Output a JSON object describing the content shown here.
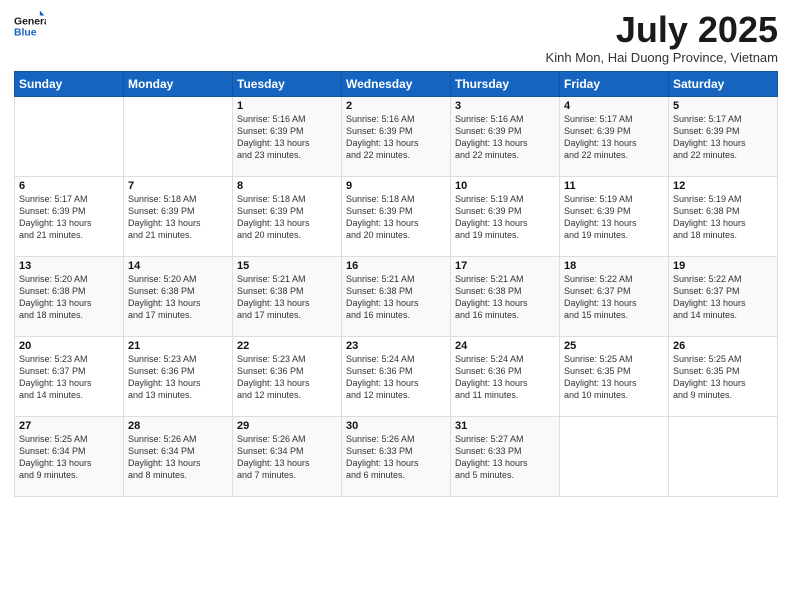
{
  "header": {
    "logo_line1": "General",
    "logo_line2": "Blue",
    "title": "July 2025",
    "location": "Kinh Mon, Hai Duong Province, Vietnam"
  },
  "days_of_week": [
    "Sunday",
    "Monday",
    "Tuesday",
    "Wednesday",
    "Thursday",
    "Friday",
    "Saturday"
  ],
  "weeks": [
    [
      {
        "day": "",
        "info": ""
      },
      {
        "day": "",
        "info": ""
      },
      {
        "day": "1",
        "info": "Sunrise: 5:16 AM\nSunset: 6:39 PM\nDaylight: 13 hours\nand 23 minutes."
      },
      {
        "day": "2",
        "info": "Sunrise: 5:16 AM\nSunset: 6:39 PM\nDaylight: 13 hours\nand 22 minutes."
      },
      {
        "day": "3",
        "info": "Sunrise: 5:16 AM\nSunset: 6:39 PM\nDaylight: 13 hours\nand 22 minutes."
      },
      {
        "day": "4",
        "info": "Sunrise: 5:17 AM\nSunset: 6:39 PM\nDaylight: 13 hours\nand 22 minutes."
      },
      {
        "day": "5",
        "info": "Sunrise: 5:17 AM\nSunset: 6:39 PM\nDaylight: 13 hours\nand 22 minutes."
      }
    ],
    [
      {
        "day": "6",
        "info": "Sunrise: 5:17 AM\nSunset: 6:39 PM\nDaylight: 13 hours\nand 21 minutes."
      },
      {
        "day": "7",
        "info": "Sunrise: 5:18 AM\nSunset: 6:39 PM\nDaylight: 13 hours\nand 21 minutes."
      },
      {
        "day": "8",
        "info": "Sunrise: 5:18 AM\nSunset: 6:39 PM\nDaylight: 13 hours\nand 20 minutes."
      },
      {
        "day": "9",
        "info": "Sunrise: 5:18 AM\nSunset: 6:39 PM\nDaylight: 13 hours\nand 20 minutes."
      },
      {
        "day": "10",
        "info": "Sunrise: 5:19 AM\nSunset: 6:39 PM\nDaylight: 13 hours\nand 19 minutes."
      },
      {
        "day": "11",
        "info": "Sunrise: 5:19 AM\nSunset: 6:39 PM\nDaylight: 13 hours\nand 19 minutes."
      },
      {
        "day": "12",
        "info": "Sunrise: 5:19 AM\nSunset: 6:38 PM\nDaylight: 13 hours\nand 18 minutes."
      }
    ],
    [
      {
        "day": "13",
        "info": "Sunrise: 5:20 AM\nSunset: 6:38 PM\nDaylight: 13 hours\nand 18 minutes."
      },
      {
        "day": "14",
        "info": "Sunrise: 5:20 AM\nSunset: 6:38 PM\nDaylight: 13 hours\nand 17 minutes."
      },
      {
        "day": "15",
        "info": "Sunrise: 5:21 AM\nSunset: 6:38 PM\nDaylight: 13 hours\nand 17 minutes."
      },
      {
        "day": "16",
        "info": "Sunrise: 5:21 AM\nSunset: 6:38 PM\nDaylight: 13 hours\nand 16 minutes."
      },
      {
        "day": "17",
        "info": "Sunrise: 5:21 AM\nSunset: 6:38 PM\nDaylight: 13 hours\nand 16 minutes."
      },
      {
        "day": "18",
        "info": "Sunrise: 5:22 AM\nSunset: 6:37 PM\nDaylight: 13 hours\nand 15 minutes."
      },
      {
        "day": "19",
        "info": "Sunrise: 5:22 AM\nSunset: 6:37 PM\nDaylight: 13 hours\nand 14 minutes."
      }
    ],
    [
      {
        "day": "20",
        "info": "Sunrise: 5:23 AM\nSunset: 6:37 PM\nDaylight: 13 hours\nand 14 minutes."
      },
      {
        "day": "21",
        "info": "Sunrise: 5:23 AM\nSunset: 6:36 PM\nDaylight: 13 hours\nand 13 minutes."
      },
      {
        "day": "22",
        "info": "Sunrise: 5:23 AM\nSunset: 6:36 PM\nDaylight: 13 hours\nand 12 minutes."
      },
      {
        "day": "23",
        "info": "Sunrise: 5:24 AM\nSunset: 6:36 PM\nDaylight: 13 hours\nand 12 minutes."
      },
      {
        "day": "24",
        "info": "Sunrise: 5:24 AM\nSunset: 6:36 PM\nDaylight: 13 hours\nand 11 minutes."
      },
      {
        "day": "25",
        "info": "Sunrise: 5:25 AM\nSunset: 6:35 PM\nDaylight: 13 hours\nand 10 minutes."
      },
      {
        "day": "26",
        "info": "Sunrise: 5:25 AM\nSunset: 6:35 PM\nDaylight: 13 hours\nand 9 minutes."
      }
    ],
    [
      {
        "day": "27",
        "info": "Sunrise: 5:25 AM\nSunset: 6:34 PM\nDaylight: 13 hours\nand 9 minutes."
      },
      {
        "day": "28",
        "info": "Sunrise: 5:26 AM\nSunset: 6:34 PM\nDaylight: 13 hours\nand 8 minutes."
      },
      {
        "day": "29",
        "info": "Sunrise: 5:26 AM\nSunset: 6:34 PM\nDaylight: 13 hours\nand 7 minutes."
      },
      {
        "day": "30",
        "info": "Sunrise: 5:26 AM\nSunset: 6:33 PM\nDaylight: 13 hours\nand 6 minutes."
      },
      {
        "day": "31",
        "info": "Sunrise: 5:27 AM\nSunset: 6:33 PM\nDaylight: 13 hours\nand 5 minutes."
      },
      {
        "day": "",
        "info": ""
      },
      {
        "day": "",
        "info": ""
      }
    ]
  ]
}
